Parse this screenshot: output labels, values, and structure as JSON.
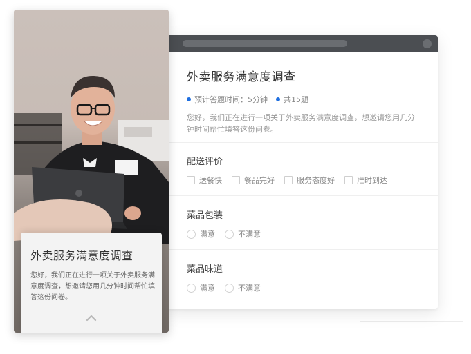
{
  "survey": {
    "title": "外卖服务满意度调查",
    "meta_time": "预计答题时间：5分钟",
    "meta_count": "共15题",
    "description": "您好，我们正在进行一项关于外卖服务满意度调查，想邀请您用几分钟时间帮忙填答这份问卷。",
    "accent_color": "#1f6fe0"
  },
  "questions": [
    {
      "title": "配送评价",
      "type": "checkbox",
      "options": [
        "送餐快",
        "餐品完好",
        "服务态度好",
        "准时到达"
      ]
    },
    {
      "title": "菜品包装",
      "type": "radio",
      "options": [
        "满意",
        "不满意"
      ]
    },
    {
      "title": "菜品味道",
      "type": "radio",
      "options": [
        "满意",
        "不满意"
      ]
    }
  ],
  "mobile": {
    "title": "外卖服务满意度调查",
    "description": "您好，我们正在进行一项关于外卖服务满意度调查，想邀请您用几分钟时间帮忙填答这份问卷。",
    "expand_icon": "chevron-up-icon"
  }
}
